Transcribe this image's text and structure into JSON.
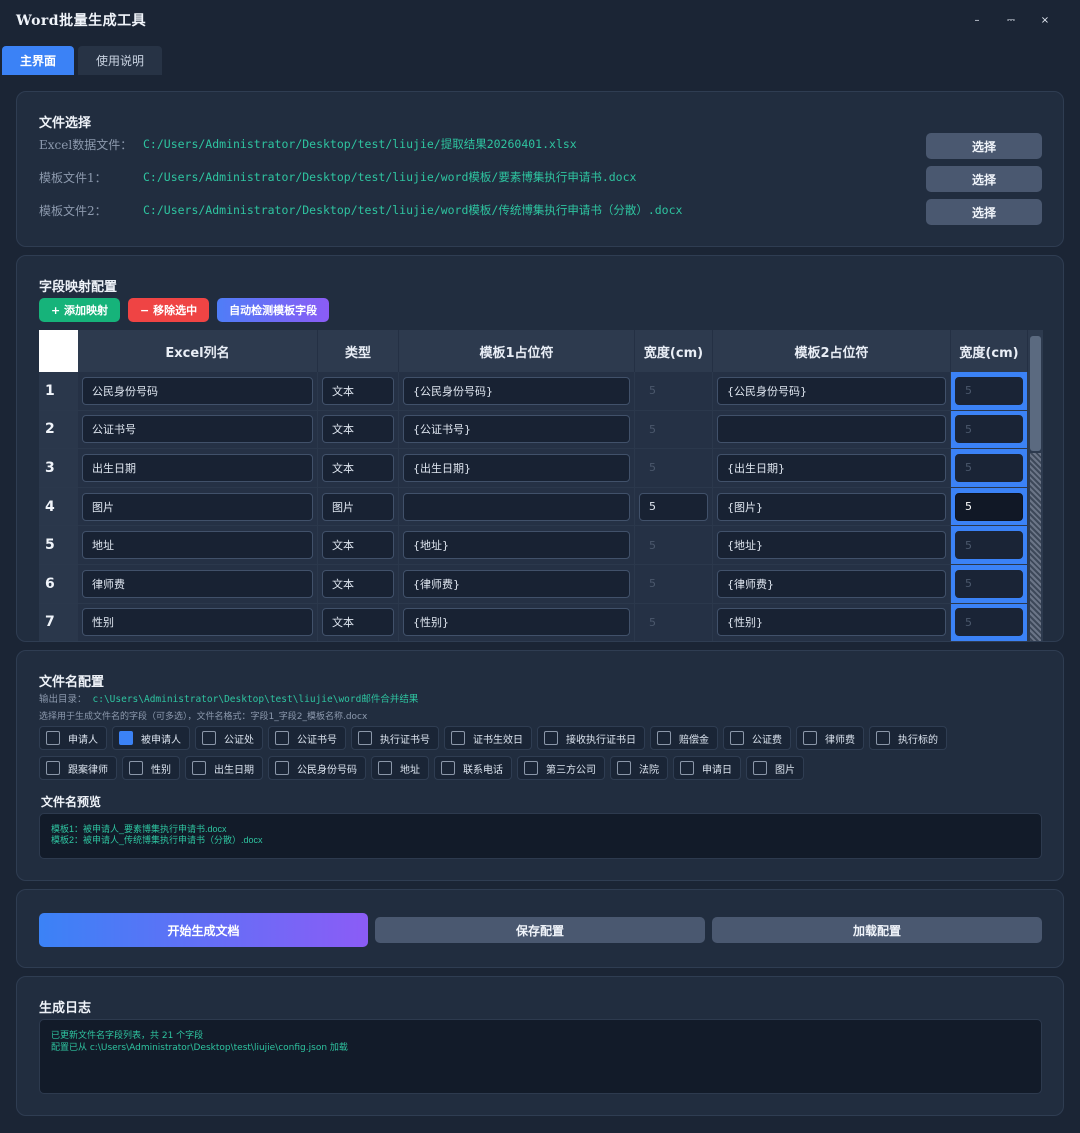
{
  "window": {
    "title": "Word批量生成工具",
    "controls": {
      "minimize": "–",
      "maximize": "⎓",
      "close": "×"
    }
  },
  "tabs": [
    {
      "label": "主界面",
      "active": true
    },
    {
      "label": "使用说明",
      "active": false
    }
  ],
  "file_section": {
    "title": "文件选择",
    "rows": [
      {
        "label": "Excel数据文件：",
        "path": "C:/Users/Administrator/Desktop/test/liujie/提取结果20260401.xlsx",
        "button": "选择"
      },
      {
        "label": "模板文件1：",
        "path": "C:/Users/Administrator/Desktop/test/liujie/word模板/要素博集执行申请书.docx",
        "button": "选择"
      },
      {
        "label": "模板文件2：",
        "path": "C:/Users/Administrator/Desktop/test/liujie/word模板/传统博集执行申请书（分散）.docx",
        "button": "选择"
      }
    ]
  },
  "mapping": {
    "title": "字段映射配置",
    "buttons": {
      "add": "+ 添加映射",
      "remove": "− 移除选中",
      "detect": "自动检测模板字段"
    },
    "headers": [
      "Excel列名",
      "类型",
      "模板1占位符",
      "宽度(cm)",
      "模板2占位符",
      "宽度(cm)"
    ],
    "rows": [
      {
        "num": "1",
        "col": "公民身份号码",
        "type": "文本",
        "ph1": "{公民身份号码}",
        "w1": "5",
        "ph2": "{公民身份号码}",
        "w2": "5"
      },
      {
        "num": "2",
        "col": "公证书号",
        "type": "文本",
        "ph1": "{公证书号}",
        "w1": "5",
        "ph2": "",
        "w2": "5"
      },
      {
        "num": "3",
        "col": "出生日期",
        "type": "文本",
        "ph1": "{出生日期}",
        "w1": "5",
        "ph2": "{出生日期}",
        "w2": "5"
      },
      {
        "num": "4",
        "col": "图片",
        "type": "图片",
        "ph1": "",
        "w1": "5",
        "ph2": "{图片}",
        "w2": "5"
      },
      {
        "num": "5",
        "col": "地址",
        "type": "文本",
        "ph1": "{地址}",
        "w1": "5",
        "ph2": "{地址}",
        "w2": "5"
      },
      {
        "num": "6",
        "col": "律师费",
        "type": "文本",
        "ph1": "{律师费}",
        "w1": "5",
        "ph2": "{律师费}",
        "w2": "5"
      },
      {
        "num": "7",
        "col": "性别",
        "type": "文本",
        "ph1": "{性别}",
        "w1": "5",
        "ph2": "{性别}",
        "w2": "5"
      }
    ]
  },
  "filename": {
    "title": "文件名配置",
    "output_label": "输出目录：",
    "output_path": "c:\\Users\\Administrator\\Desktop\\test\\liujie\\word邮件合并结果",
    "hint": "选择用于生成文件名的字段（可多选），文件名格式：字段1_字段2_模板名称.docx",
    "fields_row1": [
      {
        "label": "申请人",
        "checked": false
      },
      {
        "label": "被申请人",
        "checked": true
      },
      {
        "label": "公证处",
        "checked": false
      },
      {
        "label": "公证书号",
        "checked": false
      },
      {
        "label": "执行证书号",
        "checked": false
      },
      {
        "label": "证书生效日",
        "checked": false
      },
      {
        "label": "接收执行证书日",
        "checked": false
      },
      {
        "label": "赔偿金",
        "checked": false
      },
      {
        "label": "公证费",
        "checked": false
      },
      {
        "label": "律师费",
        "checked": false
      },
      {
        "label": "执行标的",
        "checked": false
      }
    ],
    "fields_row2": [
      {
        "label": "跟案律师",
        "checked": false
      },
      {
        "label": "性别",
        "checked": false
      },
      {
        "label": "出生日期",
        "checked": false
      },
      {
        "label": "公民身份号码",
        "checked": false
      },
      {
        "label": "地址",
        "checked": false
      },
      {
        "label": "联系电话",
        "checked": false
      },
      {
        "label": "第三方公司",
        "checked": false
      },
      {
        "label": "法院",
        "checked": false
      },
      {
        "label": "申请日",
        "checked": false
      },
      {
        "label": "图片",
        "checked": false
      }
    ],
    "preview_title": "文件名预览",
    "preview_lines": [
      "模板1：被申请人_要素博集执行申请书.docx",
      "模板2：被申请人_传统博集执行申请书（分散）.docx"
    ]
  },
  "actions": {
    "generate": "开始生成文档",
    "save": "保存配置",
    "load": "加载配置"
  },
  "log": {
    "title": "生成日志",
    "lines": [
      "已更新文件名字段列表，共 21 个字段",
      "配置已从 c:\\Users\\Administrator\\Desktop\\test\\liujie\\config.json 加载"
    ]
  },
  "colors": {
    "accent": "#3b82f6",
    "success": "#16b37a",
    "danger": "#ef4444",
    "path_text": "#2ec4a0",
    "background": "#1b2535"
  }
}
